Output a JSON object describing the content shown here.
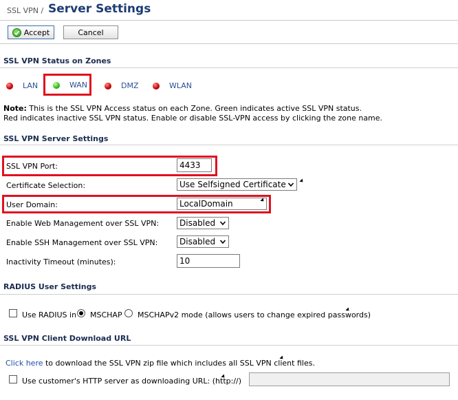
{
  "header": {
    "breadcrumb": "SSL VPN /",
    "title": "Server Settings"
  },
  "toolbar": {
    "accept_label": "Accept",
    "cancel_label": "Cancel"
  },
  "status": {
    "section_title": "SSL VPN Status on Zones",
    "zones": [
      {
        "label": "LAN",
        "state": "red"
      },
      {
        "label": "WAN",
        "state": "green"
      },
      {
        "label": "DMZ",
        "state": "red"
      },
      {
        "label": "WLAN",
        "state": "red"
      }
    ],
    "note_bold": "Note:",
    "note_line1": " This is the SSL VPN Access status on each Zone. Green indicates active SSL VPN status.",
    "note_line2": "Red indicates inactive SSL VPN status. Enable or disable SSL-VPN access by clicking the zone name."
  },
  "server": {
    "section_title": "SSL VPN Server Settings",
    "port_label": "SSL VPN Port:",
    "port_value": "4433",
    "cert_label": "Certificate Selection:",
    "cert_value": "Use Selfsigned Certificate",
    "domain_label": "User Domain:",
    "domain_value": "LocalDomain",
    "web_mgmt_label": "Enable Web Management over SSL VPN:",
    "web_mgmt_value": "Disabled",
    "ssh_mgmt_label": "Enable SSH Management over SSL VPN:",
    "ssh_mgmt_value": "Disabled",
    "timeout_label": "Inactivity Timeout (minutes):",
    "timeout_value": "10"
  },
  "radius": {
    "section_title": "RADIUS User Settings",
    "use_radius_label": "Use RADIUS in",
    "mschap_label": "MSCHAP",
    "mschapv2_label": "MSCHAPv2 mode (allows users to change expired passwords)"
  },
  "download": {
    "section_title": "SSL VPN Client Download URL",
    "click_here": "Click here",
    "click_rest": " to download the SSL VPN zip file which includes all SSL VPN client files.",
    "custom_server_label": "Use customer's HTTP server as downloading URL: (http://)"
  },
  "colors": {
    "accent": "#1d3c73",
    "highlight": "#e0101e",
    "link": "#2b4f8f"
  }
}
